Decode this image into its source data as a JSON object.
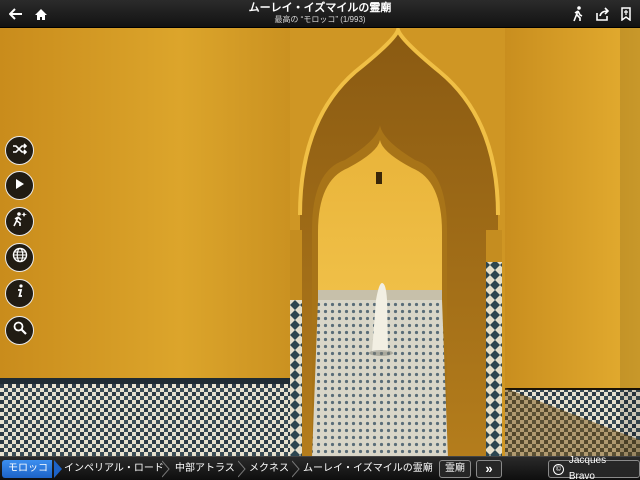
{
  "header": {
    "title": "ムーレイ・イズマイルの霊廟",
    "subtitle": "最高の “モロッコ” (1/993)",
    "left_icons": [
      "back-arrow-icon",
      "home-icon"
    ],
    "right_icons": [
      "walking-person-icon",
      "share-icon",
      "bookmark-icon"
    ]
  },
  "side_buttons": [
    {
      "name": "shuffle-icon"
    },
    {
      "name": "play-icon"
    },
    {
      "name": "explore-person-icon"
    },
    {
      "name": "globe-icon"
    },
    {
      "name": "info-icon"
    },
    {
      "name": "search-icon"
    }
  ],
  "breadcrumb": {
    "items": [
      {
        "label": "モロッコ",
        "active": true
      },
      {
        "label": "インペリアル・ロード",
        "active": false
      },
      {
        "label": "中部アトラス",
        "active": false
      },
      {
        "label": "メクネス",
        "active": false
      },
      {
        "label": "ムーレイ・イズマイルの霊廟",
        "active": false
      }
    ],
    "tag": "霊廟",
    "more_label": "»",
    "credit": "Jacques Bravo",
    "credit_symbol": "©"
  },
  "colors": {
    "accent": "#2f7ce0",
    "wall": "#d9a228",
    "bar": "#1b1b1b"
  }
}
